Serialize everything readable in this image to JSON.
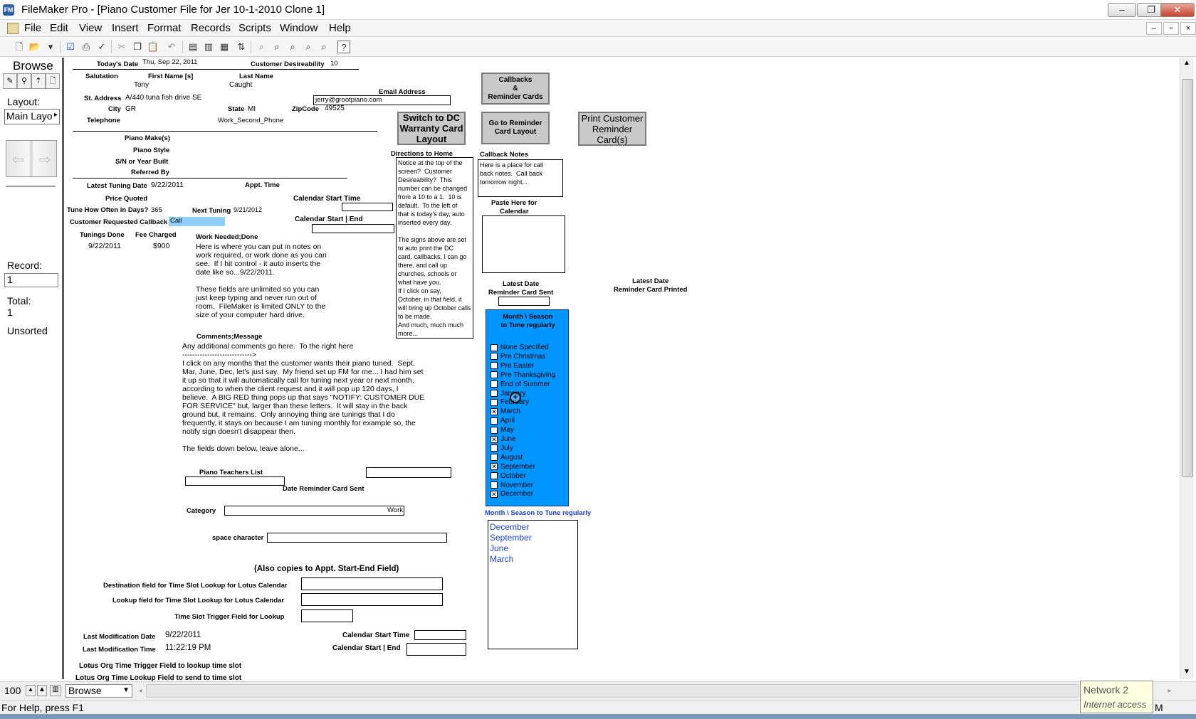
{
  "window": {
    "title": "FileMaker Pro - [Piano Customer File for Jer 10-1-2010 Clone 1]",
    "app_icon": "FileMaker-icon",
    "controls": {
      "minimize": "–",
      "restore": "❐",
      "close": "✕"
    }
  },
  "menu": {
    "items": [
      "File",
      "Edit",
      "View",
      "Insert",
      "Format",
      "Records",
      "Scripts",
      "Window",
      "Help"
    ],
    "mdi": {
      "minimize": "–",
      "restore": "▫",
      "close": "×"
    }
  },
  "status": {
    "mode": "Browse",
    "layout_label": "Layout:",
    "layout_value": "Main Layo",
    "record_label": "Record:",
    "record_value": "1",
    "total_label": "Total:",
    "total_value": "1",
    "sort_state": "Unsorted"
  },
  "header": {
    "todays_date_label": "Today's Date",
    "todays_date_value": "Thu, Sep 22, 2011",
    "desirability_label": "Customer Desireability",
    "desirability_value": "10"
  },
  "customer": {
    "salutation_label": "Salutation",
    "first_name_label": "First Name [s]",
    "first_name": "Tony",
    "last_name_label": "Last Name",
    "last_name": "Caught",
    "address_label": "St. Address",
    "address": "A/440 tuna fish drive SE",
    "email_label": "Email Address",
    "email": "jerry@grootpiano.com",
    "city_label": "City",
    "city": "GR",
    "state_label": "State",
    "state": "MI",
    "zip_label": "ZipCode",
    "zip": "49525",
    "telephone_label": "Telephone",
    "second_phone": "Work_Second_Phone"
  },
  "piano": {
    "make_label": "Piano Make(s)",
    "style_label": "Piano Style",
    "serial_label": "S/N or Year Built",
    "referred_label": "Referred By"
  },
  "tuning": {
    "latest_label": "Latest Tuning Date",
    "latest_value": "9/22/2011",
    "appt_label": "Appt. Time",
    "price_label": "Price Quoted",
    "how_often_label": "Tune How Often in Days?",
    "how_often_value": "365",
    "next_label": "Next Tuning",
    "next_value": "9/21/2012",
    "callback_label": "Customer Requested Callback",
    "callback_value": "Call",
    "done_label": "Tunings Done",
    "fee_label": "Fee Charged",
    "done_value": "9/22/2011",
    "fee_value": "$900",
    "cal_start_label": "Calendar Start Time",
    "cal_start_end_label": "Calendar Start | End"
  },
  "notes": {
    "work_label": "Work Needed;Done",
    "work_text": "Here is where you can put in notes on\nwork required, or work done as you can\nsee.  If I hit control - it auto inserts the\ndate like so...9/22/2011.\n\nThese fields are unlimited so you can\njust keep typing and never run out of\nroom.  FileMaker is limited ONLY to the\nsize of your computer hard drive.",
    "comments_label": "Comments;Message",
    "comments_text": "Any additional comments go here.  To the right here\n---------------------------->\nI click on any months that the customer wants their piano tuned.  Sept,\nMar, June, Dec, let's just say.  My friend set up FM for me... I had him set\nit up so that it will automatically call for tuning next year or next month,\naccording to when the client request and it will pop up 120 days, I\nbelieve.  A BIG RED thing pops up that says \"NOTIFY: CUSTOMER DUE\nFOR SERVICE\" but, larger than these letters.  It will stay in the back\nground but, it remains.  Only annoying thing are tunings that I do\nfrequently, it stays on because I am tuning monthly for example so, the\nnotify sign doesn't disappear then.\n\nThe fields down below, leave alone..."
  },
  "directions": {
    "label": "Directions to Home",
    "text": "Notice at the top of the\nscreen?  Customer\nDesireability?  This\nnumber can be changed\nfrom a 10 to a 1.  10 is\ndefault.  To the left of\nthat is today's day, auto\ninserted every day.\n\nThe signs above are set\nto auto print the DC\ncard, callbacks, I can go\nthere, and call up\nchurches, schools or\nwhat have you.\nIf I click on say,\nOctober, in that field, it\nwill bring up October calls\nto be made.\nAnd much, much much\nmore..."
  },
  "buttons": {
    "switch_dc": "Switch to DC Warranty Card Layout",
    "callbacks": "Callbacks\n&\nReminder Cards",
    "go_reminder": "Go to Reminder Card Layout",
    "print_reminder": "Print Customer Reminder Card(s)"
  },
  "callback": {
    "notes_label": "Callback Notes",
    "notes_text": "Here is a place for call\nback notes.  Call back\ntomorrow night...",
    "paste_label": "Paste Here for\nCalendar",
    "latest_sent_label": "Latest Date\nReminder Card Sent",
    "latest_printed_label": "Latest Date\nReminder Card Printed"
  },
  "months": {
    "panel_title": "Month \\ Season\nto Tune regularly",
    "options": [
      {
        "label": "None Specified",
        "checked": false
      },
      {
        "label": "Pre Christmas",
        "checked": false
      },
      {
        "label": "Pre Easter",
        "checked": false
      },
      {
        "label": "Pre Thanksgiving",
        "checked": false
      },
      {
        "label": "End of Summer",
        "checked": false
      },
      {
        "label": "January",
        "checked": false
      },
      {
        "label": "February",
        "checked": false
      },
      {
        "label": "March",
        "checked": true
      },
      {
        "label": "April",
        "checked": false
      },
      {
        "label": "May",
        "checked": false
      },
      {
        "label": "June",
        "checked": true
      },
      {
        "label": "July",
        "checked": false
      },
      {
        "label": "August",
        "checked": false
      },
      {
        "label": "September",
        "checked": true
      },
      {
        "label": "October",
        "checked": false
      },
      {
        "label": "November",
        "checked": false
      },
      {
        "label": "December",
        "checked": true
      }
    ],
    "list_label": "Month \\ Season to Tune regularly",
    "selected_list": [
      "December",
      "September",
      "June",
      "March"
    ]
  },
  "lower": {
    "teachers_label": "Piano Teachers List",
    "date_reminder_label": "Date Reminder Card Sent",
    "category_label": "Category",
    "category_value": "Work",
    "space_label": "space character",
    "also_copies": "(Also copies to Appt. Start-End Field)",
    "dest_label": "Destination field for Time Slot Lookup for Lotus Calendar",
    "lookup_label": "Lookup field for Time Slot Lookup for Lotus Calendar",
    "trigger_label": "Time Slot Trigger Field for Lookup",
    "mod_date_label": "Last Modification Date",
    "mod_date_value": "9/22/2011",
    "mod_time_label": "Last Modification Time",
    "mod_time_value": "11:22:19 PM",
    "cal_start_label": "Calendar Start Time",
    "cal_start_end_label": "Calendar Start | End",
    "lotus_trigger_label": "Lotus Org Time Trigger Field to lookup time slot",
    "lotus_lookup_label": "Lotus Org Time Lookup Field to send to time slot"
  },
  "bottom": {
    "zoom": "100",
    "mode_select": "Browse",
    "help_text": "For Help, press F1",
    "network_title": "Network  2",
    "network_status": "Internet access",
    "status_suffix": "M"
  }
}
